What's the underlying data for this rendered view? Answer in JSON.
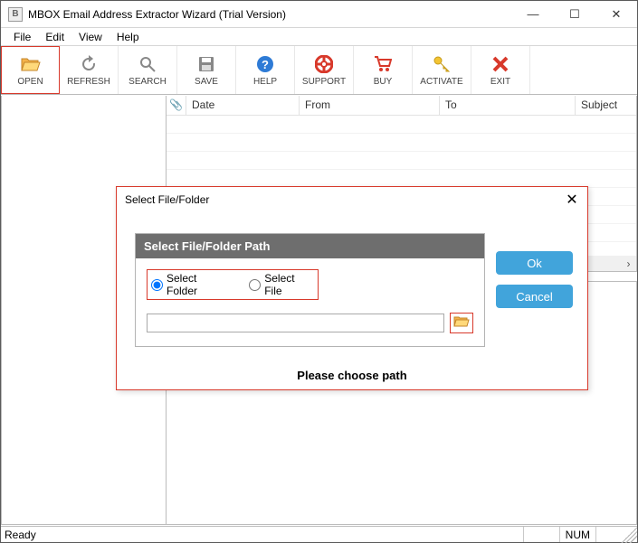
{
  "window": {
    "title": "MBOX Email Address Extractor Wizard (Trial Version)",
    "minimize_glyph": "—",
    "maximize_glyph": "☐",
    "close_glyph": "✕"
  },
  "menu": {
    "file": "File",
    "edit": "Edit",
    "view": "View",
    "help": "Help"
  },
  "toolbar": {
    "open": "OPEN",
    "refresh": "REFRESH",
    "search": "SEARCH",
    "save": "SAVE",
    "help": "HELP",
    "support": "SUPPORT",
    "buy": "BUY",
    "activate": "ACTIVATE",
    "exit": "EXIT"
  },
  "grid": {
    "columns": {
      "attachment": "",
      "date": "Date",
      "from": "From",
      "to": "To",
      "subject": "Subject"
    }
  },
  "statusbar": {
    "ready": "Ready",
    "num": "NUM"
  },
  "dialog": {
    "title": "Select File/Folder",
    "panel_title": "Select File/Folder Path",
    "radio_folder": "Select Folder",
    "radio_file": "Select File",
    "path_value": "",
    "ok": "Ok",
    "cancel": "Cancel",
    "message": "Please choose path",
    "close_glyph": "✕",
    "selected_option": "folder"
  },
  "icons": {
    "app": "B",
    "paperclip": "📎"
  }
}
